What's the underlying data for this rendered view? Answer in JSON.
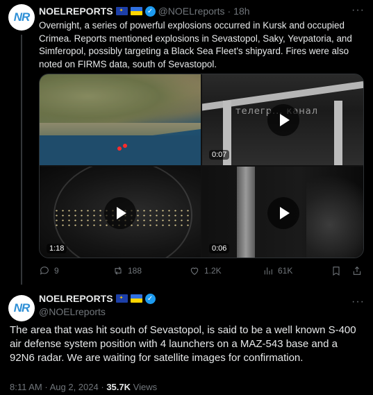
{
  "post1": {
    "avatar_text": "NR",
    "display_name": "NOELREPORTS",
    "handle": "@NOELreports",
    "separator": "·",
    "time": "18h",
    "more": "···",
    "text": "Overnight, a series of powerful explosions occurred in Kursk and occupied Crimea. Reports mentioned explosions in Sevastopol, Saky, Yevpatoria, and Simferopol, possibly targeting a Black Sea Fleet's shipyard. Fires were also noted on FIRMS data, south of Sevastopol.",
    "media": {
      "tiles": [
        {
          "kind": "map image",
          "duration": ""
        },
        {
          "kind": "video",
          "duration": "0:07",
          "watermark": "телегр... канал"
        },
        {
          "kind": "video",
          "duration": "1:18"
        },
        {
          "kind": "video",
          "duration": "0:06"
        }
      ]
    },
    "actions": {
      "replies": "9",
      "reposts": "188",
      "likes": "1.2K",
      "views": "61K"
    }
  },
  "post2": {
    "avatar_text": "NR",
    "display_name": "NOELREPORTS",
    "handle": "@NOELreports",
    "more": "···",
    "text": "The area that was hit south of Sevastopol, is said to be a well known S-400 air defense system position with 4 launchers on a MAZ-543 base and a 92N6 radar. We are waiting for satellite images for confirmation.",
    "time": "8:11 AM",
    "date": "Aug 2, 2024",
    "separator": "·",
    "views_count": "35.7K",
    "views_label": "Views"
  },
  "colors": {
    "background": "#000000",
    "text": "#e7e9ea",
    "muted": "#71767b",
    "verified": "#1d9bf0"
  }
}
